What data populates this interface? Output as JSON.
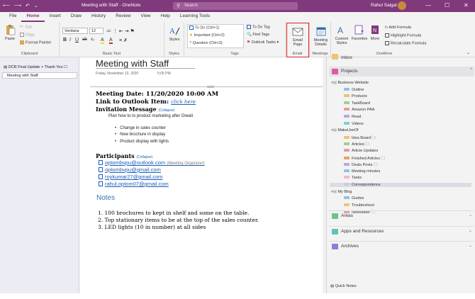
{
  "window": {
    "title": "Meeting with Staff  -  OneNote",
    "search_placeholder": "Search",
    "user": "Rahul Saigal",
    "minimize": "—",
    "maximize": "☐",
    "close": "✕"
  },
  "qat": {
    "back": "⟵",
    "forward": "⟶",
    "undo": "↶",
    "more": "⌄"
  },
  "tabs": [
    "File",
    "Home",
    "Insert",
    "Draw",
    "History",
    "Review",
    "View",
    "Help",
    "Learning Tools"
  ],
  "ribbon": {
    "clipboard": {
      "paste": "Paste",
      "cut": "Cut",
      "copy": "Copy",
      "format_painter": "Format Painter",
      "label": "Clipboard"
    },
    "basic_text": {
      "font": "Verdana",
      "size": "12",
      "label": "Basic Text",
      "bold": "B",
      "italic": "I",
      "underline": "U",
      "strike": "ab",
      "sub": "x₂",
      "color": "A",
      "clear": "✗"
    },
    "styles": {
      "styles": "Styles",
      "label": "Styles"
    },
    "tags": {
      "todo": "To Do (Ctrl+1)",
      "important": "Important (Ctrl+2)",
      "question": "Question (Ctrl+3)",
      "todo_tag": "To Do Tag",
      "find_tags": "Find Tags",
      "outlook_tasks": "Outlook Tasks",
      "label": "Tags"
    },
    "email": {
      "email_page": "Email Page",
      "label": "Email"
    },
    "meetings": {
      "meeting_details": "Meeting Details",
      "label": "Meetings"
    },
    "onemore": {
      "custom_styles": "Custom Styles",
      "favorites": "Favorites",
      "more": "More",
      "add_formula": "Add Formula",
      "highlight_formula": "Highlight Formula",
      "recalc_formula": "Recalculate Formula",
      "label": "OneMore"
    }
  },
  "left": {
    "section": "DCR Final Update + Thank You ☐",
    "page": "Meeting with Staff"
  },
  "page": {
    "title": "Meeting with Staff",
    "date": "Friday, November 13, 2020",
    "time": "5:05 PM",
    "meeting_date": "Meeting Date: 11/20/2020 10:00 AM",
    "link_label": "Link to Outlook Item:",
    "link_text": "click here",
    "invitation": "Invitation Message",
    "collapse": "(Collapse)",
    "plan": "Plan how to to product marketing after Diwali",
    "bullets": [
      "Change in sales counter",
      "New brochure in display",
      "Product display with lights"
    ],
    "participants": "Participants",
    "attendees": [
      {
        "email": "optombvpu@outlook.com",
        "note": "(Meeting Organizer)"
      },
      {
        "email": "optombvpu@gmail.com",
        "note": ""
      },
      {
        "email": "roykumar27@gmail.com",
        "note": ""
      },
      {
        "email": "rahul.optom07@gmail.com",
        "note": ""
      }
    ],
    "notes_heading": "Notes",
    "notes": [
      "1.   100 brochures to kept in shelf and some on the table.",
      "2.   Top stationary items to be at the top of the sales counter.",
      "3.   LED lights (10 in number) at all sides"
    ]
  },
  "notebooks": {
    "inbox": "Inbox",
    "projects": "Projects",
    "areas": "Areas",
    "apps": "Apps and Resources",
    "archives": "Archives",
    "sections": [
      {
        "name": "Business Website",
        "group": true
      },
      {
        "name": "Outline",
        "color": "#8bc5e8"
      },
      {
        "name": "Products",
        "color": "#f0c36e"
      },
      {
        "name": "TaskBoard",
        "color": "#9ed08f"
      },
      {
        "name": "Amazon PAA",
        "color": "#e89a9a"
      },
      {
        "name": "Read",
        "color": "#b7a6e0"
      },
      {
        "name": "Videos",
        "color": "#7fd0c5"
      },
      {
        "name": "MakeUseOf",
        "group": true
      },
      {
        "name": "Idea Board 🗀",
        "color": "#f0c36e"
      },
      {
        "name": "Articles 🗀",
        "color": "#9ed08f"
      },
      {
        "name": "Article Updates",
        "color": "#e89a9a"
      },
      {
        "name": "Finished Articles 🗀",
        "color": "#e8a25a"
      },
      {
        "name": "Deals Posts 🗀",
        "color": "#b7a6e0"
      },
      {
        "name": "Meeting minutes",
        "color": "#8bc5e8"
      },
      {
        "name": "Tasks",
        "color": "#f0b7d0"
      },
      {
        "name": "Correspondence",
        "color": "#c9c9e8",
        "active": true
      },
      {
        "name": "My Blog",
        "group": true
      },
      {
        "name": "Guides",
        "color": "#8bc5e8"
      },
      {
        "name": "Troubleshoot",
        "color": "#f0c36e"
      },
      {
        "name": "Newsletter 🗀",
        "color": "#e89a9a"
      }
    ],
    "quick_notes": "Quick Notes"
  },
  "colors": {
    "accent": "#80397b",
    "link": "#1a5eb8",
    "notes": "#2e74b5",
    "highlight": "#e02020"
  }
}
